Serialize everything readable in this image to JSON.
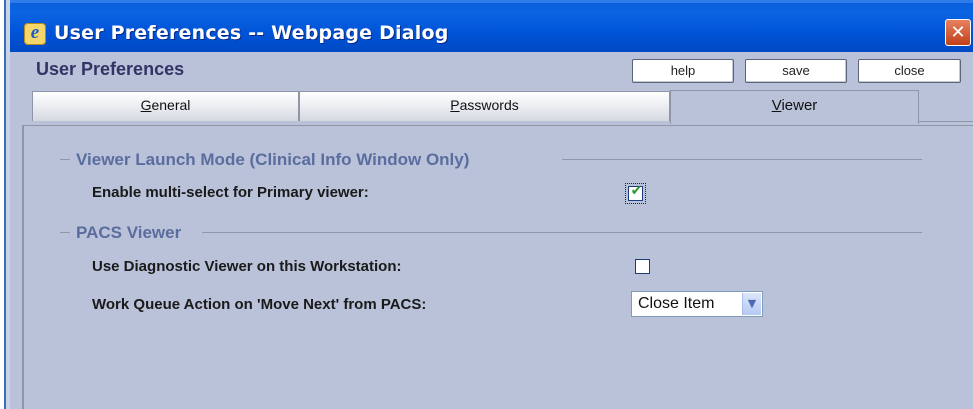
{
  "window": {
    "title": "User Preferences -- Webpage Dialog",
    "close_glyph": "✕",
    "app_icon": "e"
  },
  "header": {
    "title": "User Preferences",
    "help_label": "help",
    "save_label": "save",
    "close_label": "close"
  },
  "tabs": [
    {
      "label_acc": "G",
      "label_rest": "eneral",
      "active": false
    },
    {
      "label_acc": "P",
      "label_rest": "asswords",
      "active": false
    },
    {
      "label_acc": "V",
      "label_rest": "iewer",
      "active": true
    }
  ],
  "sections": {
    "launch_mode": {
      "title": "Viewer Launch Mode (Clinical Info Window Only)",
      "multi_select_label": "Enable multi-select for Primary viewer:",
      "multi_select_checked": true,
      "check_glyph": "✔"
    },
    "pacs": {
      "title": "PACS Viewer",
      "diagnostic_label": "Use Diagnostic Viewer on this Workstation:",
      "diagnostic_checked": false,
      "move_next_label": "Work Queue Action on 'Move Next' from PACS:",
      "move_next_value": "Close Item",
      "dropdown_arrow": "▼"
    }
  },
  "colors": {
    "titlebar": "#0054d8",
    "dialog_bg": "#b9c2d9",
    "section_title": "#5b6d9e"
  }
}
